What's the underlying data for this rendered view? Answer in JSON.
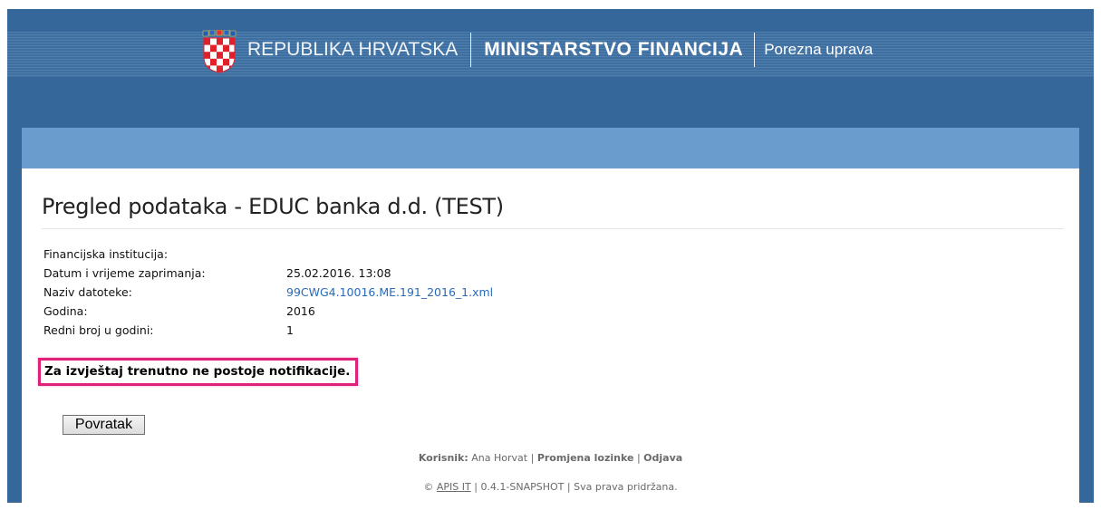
{
  "header": {
    "republic": "REPUBLIKA HRVATSKA",
    "ministry": "MINISTARSTVO FINANCIJA",
    "agency": "Porezna uprava"
  },
  "page": {
    "title": "Pregled podataka - EDUC banka d.d. (TEST)"
  },
  "details": [
    {
      "label": "Financijska institucija:",
      "value": ""
    },
    {
      "label": "Datum i vrijeme zaprimanja:",
      "value": "25.02.2016. 13:08"
    },
    {
      "label": "Naziv datoteke:",
      "value": "99CWG4.10016.ME.191_2016_1.xml"
    },
    {
      "label": "Godina:",
      "value": "2016"
    },
    {
      "label": "Redni broj u godini:",
      "value": "1"
    }
  ],
  "notice": "Za izvještaj trenutno ne postoje notifikacije.",
  "buttons": {
    "back": "Povratak"
  },
  "footer": {
    "user_label": "Korisnik:",
    "user_name": "Ana Horvat",
    "sep": "|",
    "change_password": "Promjena lozinke",
    "logout": "Odjava",
    "copyright_symbol": "©",
    "company": "APIS IT",
    "version": "0.4.1-SNAPSHOT",
    "rights": "Sva prava pridržana."
  },
  "colors": {
    "header_bg": "#35679a",
    "content_bar": "#6a9ccd",
    "link": "#2a6ab8",
    "highlight": "#e0217a"
  }
}
